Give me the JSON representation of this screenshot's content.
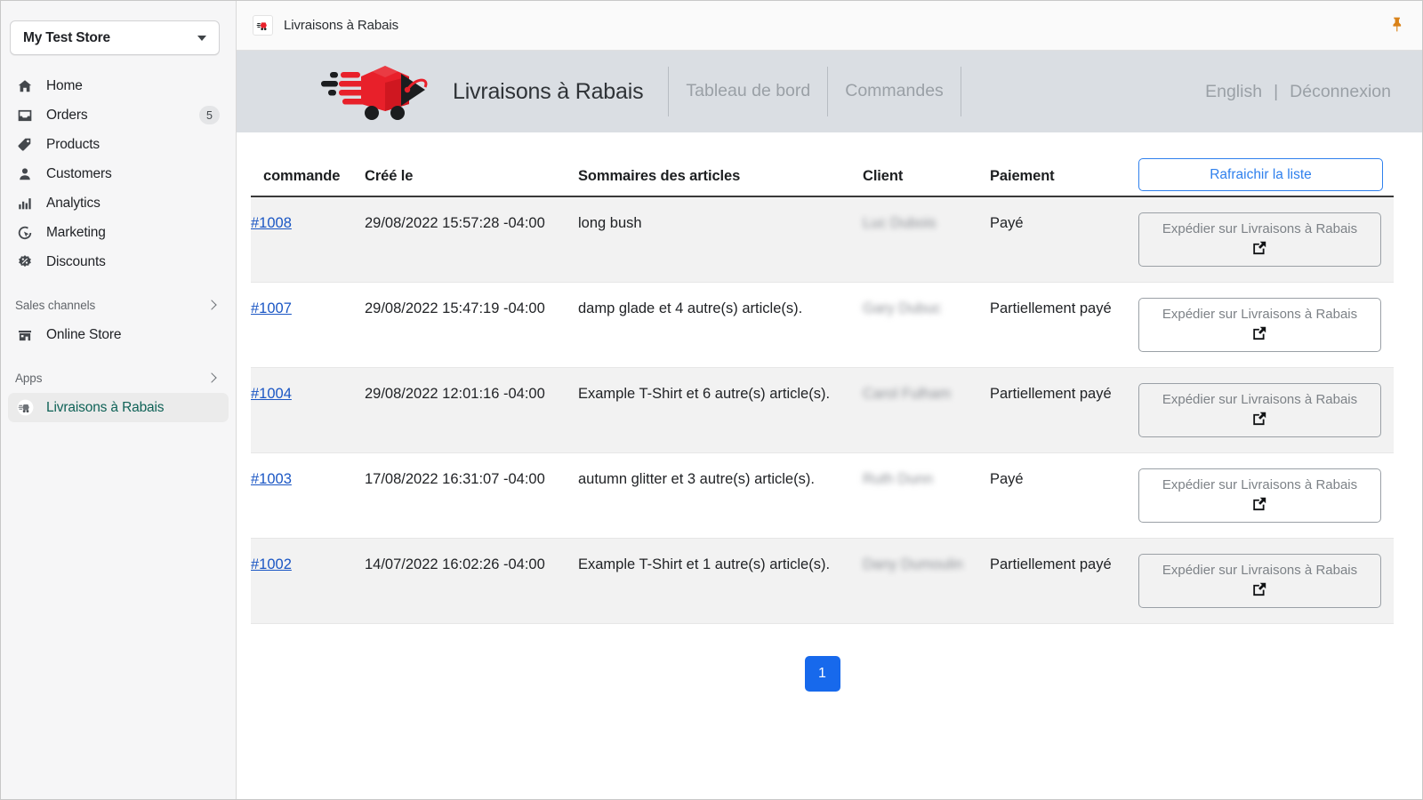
{
  "sidebar": {
    "store": {
      "name": "My Test Store",
      "caret": "chevron-down"
    },
    "items": [
      {
        "icon": "home",
        "label": "Home",
        "badge": ""
      },
      {
        "icon": "orders",
        "label": "Orders",
        "badge": "5"
      },
      {
        "icon": "products",
        "label": "Products",
        "badge": ""
      },
      {
        "icon": "customers",
        "label": "Customers",
        "badge": ""
      },
      {
        "icon": "analytics",
        "label": "Analytics",
        "badge": ""
      },
      {
        "icon": "marketing",
        "label": "Marketing",
        "badge": ""
      },
      {
        "icon": "discounts",
        "label": "Discounts",
        "badge": ""
      }
    ],
    "sales_channels": {
      "label": "Sales channels",
      "items": [
        {
          "icon": "store",
          "label": "Online Store"
        }
      ]
    },
    "apps": {
      "label": "Apps",
      "items": [
        {
          "icon": "app-logo",
          "label": "Livraisons à Rabais",
          "selected": true
        }
      ]
    }
  },
  "appbar": {
    "title": "Livraisons à Rabais",
    "favicon": "app-logo-icon",
    "pin": "📌"
  },
  "app_header": {
    "brand_name": "Livraisons à Rabais",
    "logo": "delivery-box-logo",
    "nav": [
      "Tableau de bord",
      "Commandes"
    ],
    "language": "English",
    "separator": "|",
    "logout": "Déconnexion"
  },
  "table": {
    "columns": [
      "commande",
      "Créé le",
      "Sommaires des articles",
      "Client",
      "Paiement"
    ],
    "refresh_label": "Rafraichir la liste",
    "ship_label": "Expédier sur Livraisons à Rabais",
    "rows": [
      {
        "order": "#1008",
        "created": "29/08/2022 15:57:28 -04:00",
        "summary": "long bush",
        "client": "Luc Dubois",
        "payment": "Payé"
      },
      {
        "order": "#1007",
        "created": "29/08/2022 15:47:19 -04:00",
        "summary": "damp glade et 4 autre(s) article(s).",
        "client": "Gary Dubuc",
        "payment": "Partiellement payé"
      },
      {
        "order": "#1004",
        "created": "29/08/2022 12:01:16 -04:00",
        "summary": "Example T-Shirt et 6 autre(s) article(s).",
        "client": "Carol Fulham",
        "payment": "Partiellement payé"
      },
      {
        "order": "#1003",
        "created": "17/08/2022 16:31:07 -04:00",
        "summary": "autumn glitter et 3 autre(s) article(s).",
        "client": "Ruth Dunn",
        "payment": "Payé"
      },
      {
        "order": "#1002",
        "created": "14/07/2022 16:02:26 -04:00",
        "summary": "Example T-Shirt et 1 autre(s) article(s).",
        "client": "Dany Dumoulin",
        "payment": "Partiellement payé"
      }
    ]
  },
  "pagination": {
    "current": "1"
  },
  "colors": {
    "accent_blue": "#1769ec",
    "link_blue": "#1a56c4",
    "brand_red": "#e8202a",
    "selected_green": "#0f6257",
    "header_gray": "#dadee3",
    "pin_orange": "#d98218"
  }
}
